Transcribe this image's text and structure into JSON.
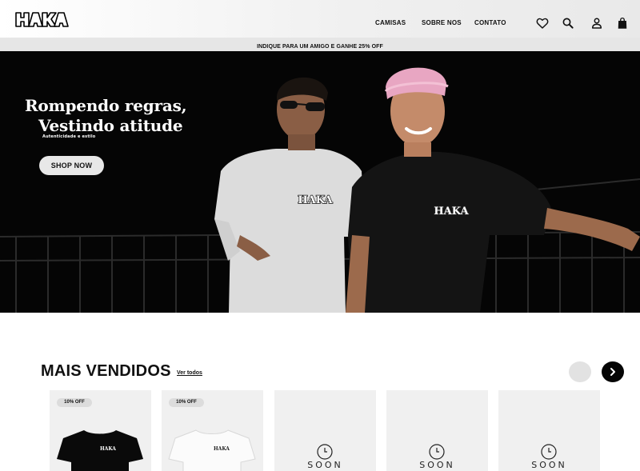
{
  "header": {
    "logo_text": "HAKA",
    "nav": [
      "CAMISAS",
      "SOBRE NOS",
      "CONTATO"
    ],
    "icons": [
      "heart-icon",
      "search-icon",
      "user-icon",
      "shopping-bag-icon"
    ]
  },
  "promo": {
    "text": "INDIQUE PARA UM AMIGO E GANHE 25% OFF"
  },
  "hero": {
    "title_line1": "Rompendo regras,",
    "title_line2": "Vestindo atitude",
    "subtitle": "Autenticidade e estilo",
    "cta": "SHOP NOW",
    "shirt_print": "HAKA"
  },
  "best_sellers": {
    "title": "MAIS VENDIDOS",
    "see_all": "Ver todos",
    "products": [
      {
        "badge": "10% OFF",
        "shirt_color": "black",
        "print": "HAKA"
      },
      {
        "badge": "10% OFF",
        "shirt_color": "white",
        "print": "HAKA"
      },
      {
        "placeholder": "SOON"
      },
      {
        "placeholder": "SOON"
      },
      {
        "placeholder": "SOON"
      }
    ]
  },
  "colors": {
    "background": "#ffffff",
    "hero_bg": "#050505",
    "button_light": "#e8e8e8",
    "card_bg": "#f0f0f0"
  }
}
